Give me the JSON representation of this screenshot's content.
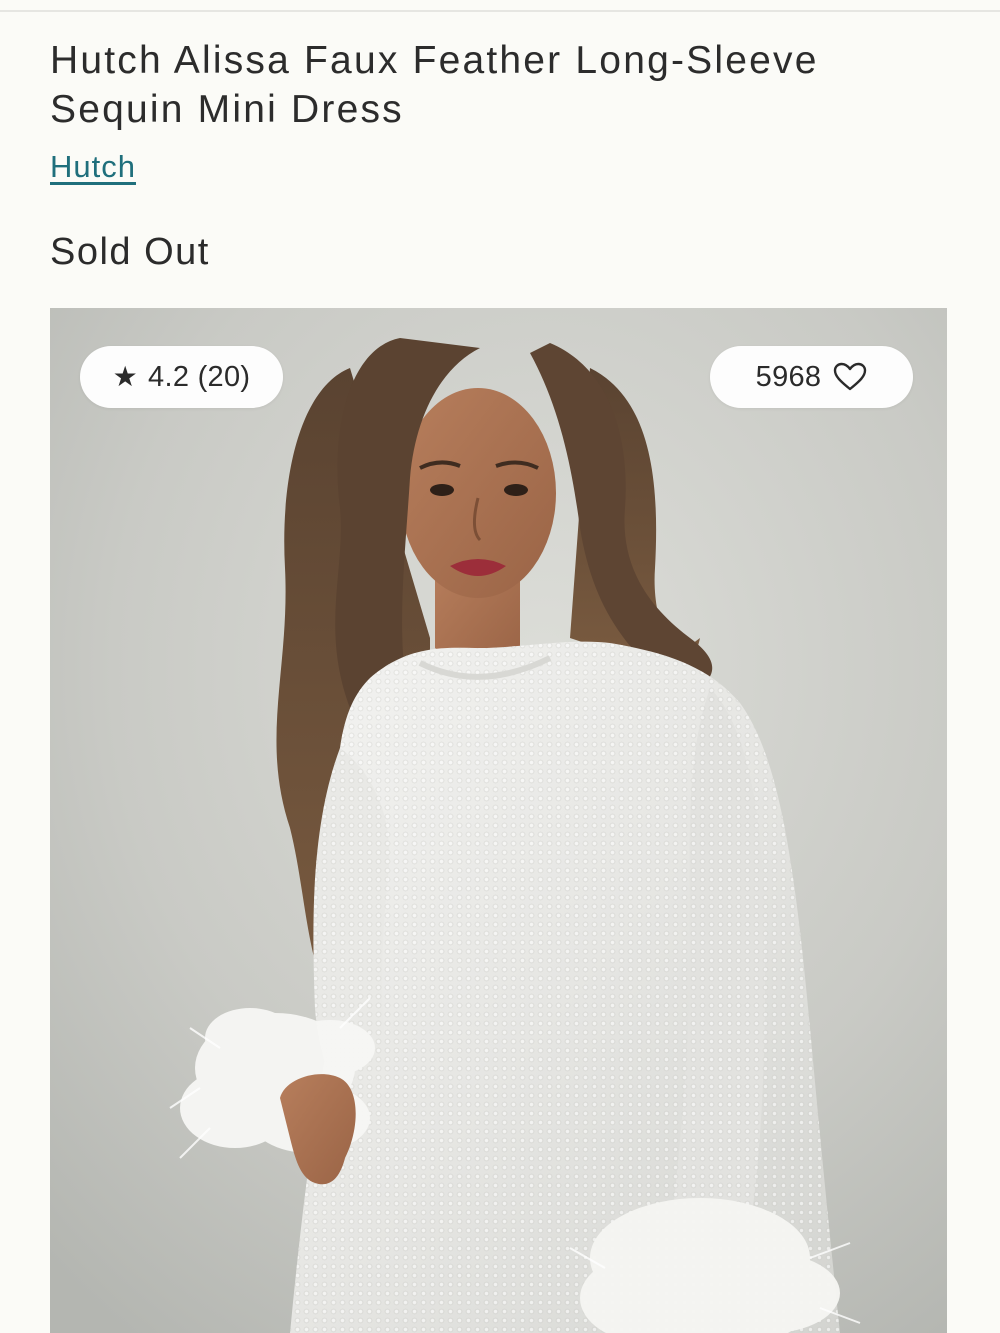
{
  "product": {
    "title": "Hutch Alissa Faux Feather Long-Sleeve Sequin Mini Dress",
    "brand": "Hutch",
    "status": "Sold Out"
  },
  "image": {
    "rating": {
      "icon": "star-icon",
      "star": "★",
      "text": "4.2 (20)"
    },
    "favorites": {
      "count": "5968",
      "icon": "heart-icon"
    }
  },
  "colors": {
    "link": "#1f6f7c",
    "background": "#fbfbf7",
    "text": "#2b2b2b"
  }
}
